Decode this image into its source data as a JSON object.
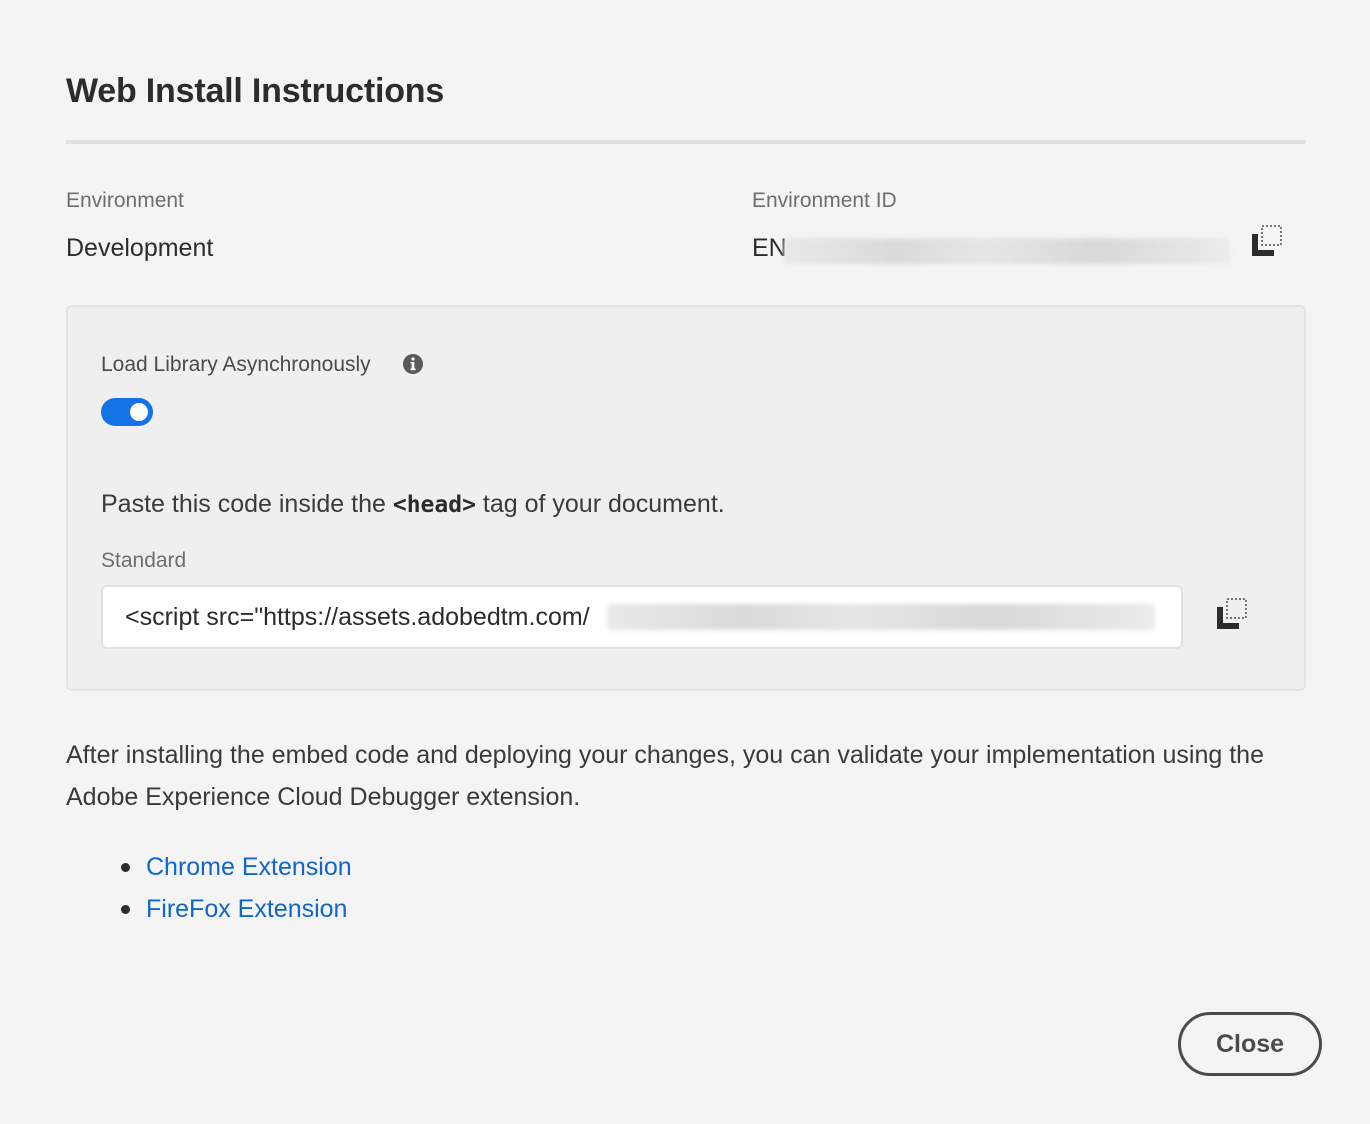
{
  "dialog": {
    "title": "Web Install Instructions"
  },
  "environment": {
    "label": "Environment",
    "value": "Development"
  },
  "environment_id": {
    "label": "Environment ID",
    "value_prefix": "EN"
  },
  "panel": {
    "async_label": "Load Library Asynchronously",
    "async_enabled": true,
    "paste_before": "Paste this code inside the ",
    "paste_tag": "<head>",
    "paste_after": " tag of your document.",
    "standard_label": "Standard",
    "code_value": "<script src=\"https://assets.adobedtm.com/"
  },
  "validation": {
    "text": "After installing the embed code and deploying your changes, you can validate your implementation using the Adobe Experience Cloud Debugger extension."
  },
  "extensions": [
    {
      "label": "Chrome Extension"
    },
    {
      "label": "FireFox Extension"
    }
  ],
  "footer": {
    "close_label": "Close"
  },
  "colors": {
    "accent": "#1473e6",
    "link": "#1166c7",
    "background": "#f4f4f4"
  },
  "icons": {
    "copy": "copy-icon",
    "info": "info-icon"
  }
}
